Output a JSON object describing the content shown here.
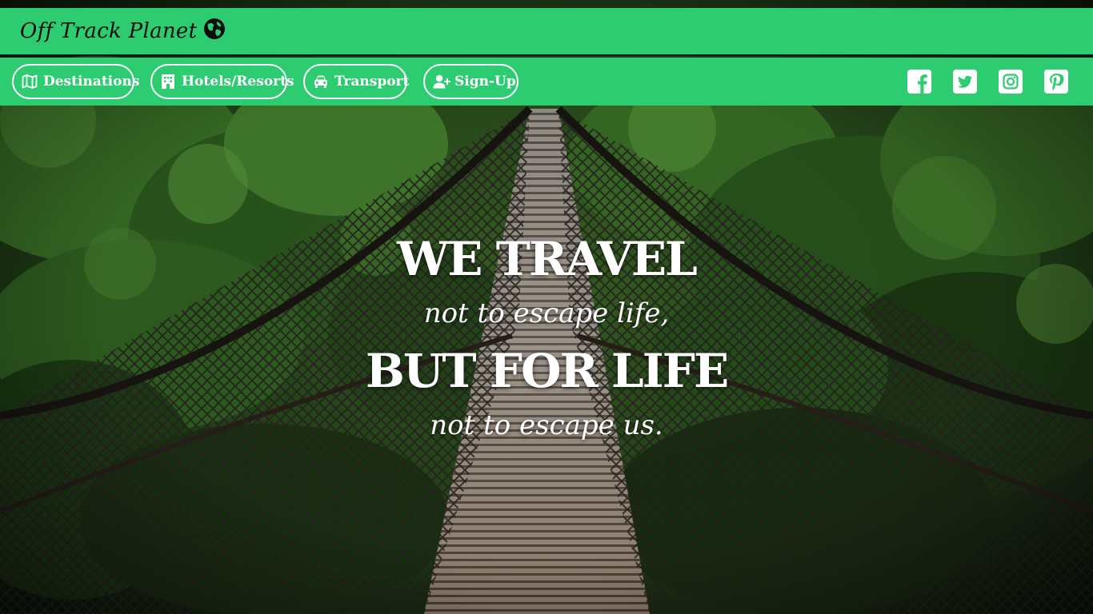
{
  "brand": {
    "name": "Off Track Planet",
    "icon": "globe-icon"
  },
  "nav": {
    "items": [
      {
        "label": "Destinations",
        "icon": "map-icon"
      },
      {
        "label": "Hotels/Resorts",
        "icon": "hotel-icon"
      },
      {
        "label": "Transport",
        "icon": "car-icon"
      },
      {
        "label": "Sign-Up",
        "icon": "user-plus-icon"
      }
    ]
  },
  "social": [
    {
      "name": "Facebook",
      "icon": "facebook-icon"
    },
    {
      "name": "Twitter",
      "icon": "twitter-icon"
    },
    {
      "name": "Instagram",
      "icon": "instagram-icon"
    },
    {
      "name": "Pinterest",
      "icon": "pinterest-icon"
    }
  ],
  "hero": {
    "line1": "WE TRAVEL",
    "line2": "not to escape life,",
    "line3": "BUT FOR LIFE",
    "line4": "not to escape us."
  },
  "colors": {
    "accent": "#2ecc71",
    "text_light": "#ffffff",
    "text_dark": "#0d0d0d"
  }
}
